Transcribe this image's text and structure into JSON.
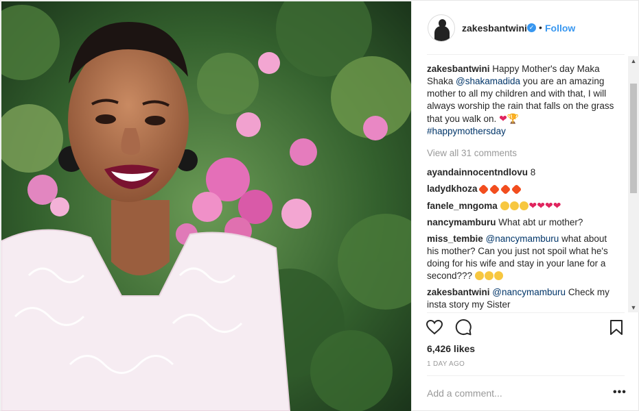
{
  "post": {
    "username": "zakesbantwini",
    "follow_label": "Follow",
    "separator": "•",
    "verified_glyph": "✓"
  },
  "caption": {
    "user": "zakesbantwini",
    "text_1": "Happy Mother's day Maka Shaka",
    "mention": "@shakamadida",
    "text_2": "you are an amazing mother to all my children and with that, I will always worship the rain that falls on the grass that you walk on.",
    "hashtag": "#happymothersday"
  },
  "view_all_comments": "View all 31 comments",
  "comments": [
    {
      "user": "ayandainnocentndlovu",
      "text": "8"
    },
    {
      "user": "ladydkhoza",
      "text": ""
    },
    {
      "user": "fanele_mngoma",
      "text": ""
    },
    {
      "user": "nancymamburu",
      "text": "What abt ur mother?"
    },
    {
      "user": "miss_tembie",
      "mention": "@nancymamburu",
      "text": "what about his mother? Can you just not spoil what he's doing for his wife and stay in your lane for a second???"
    },
    {
      "user": "zakesbantwini",
      "mention": "@nancymamburu",
      "text": "Check my insta story my Sister"
    }
  ],
  "likes": "6,426 likes",
  "timestamp": "1 DAY AGO",
  "comment_input": {
    "placeholder": "Add a comment..."
  },
  "more_options": "•••",
  "scrollbar": {
    "up": "▲",
    "down": "▼"
  },
  "colors": {
    "link": "#3897f0",
    "mention": "#003569",
    "muted": "#999999",
    "heart": "#e0245e"
  },
  "icons": [
    "heart-icon",
    "comment-icon",
    "bookmark-icon",
    "verified-badge-icon",
    "more-options-icon"
  ]
}
